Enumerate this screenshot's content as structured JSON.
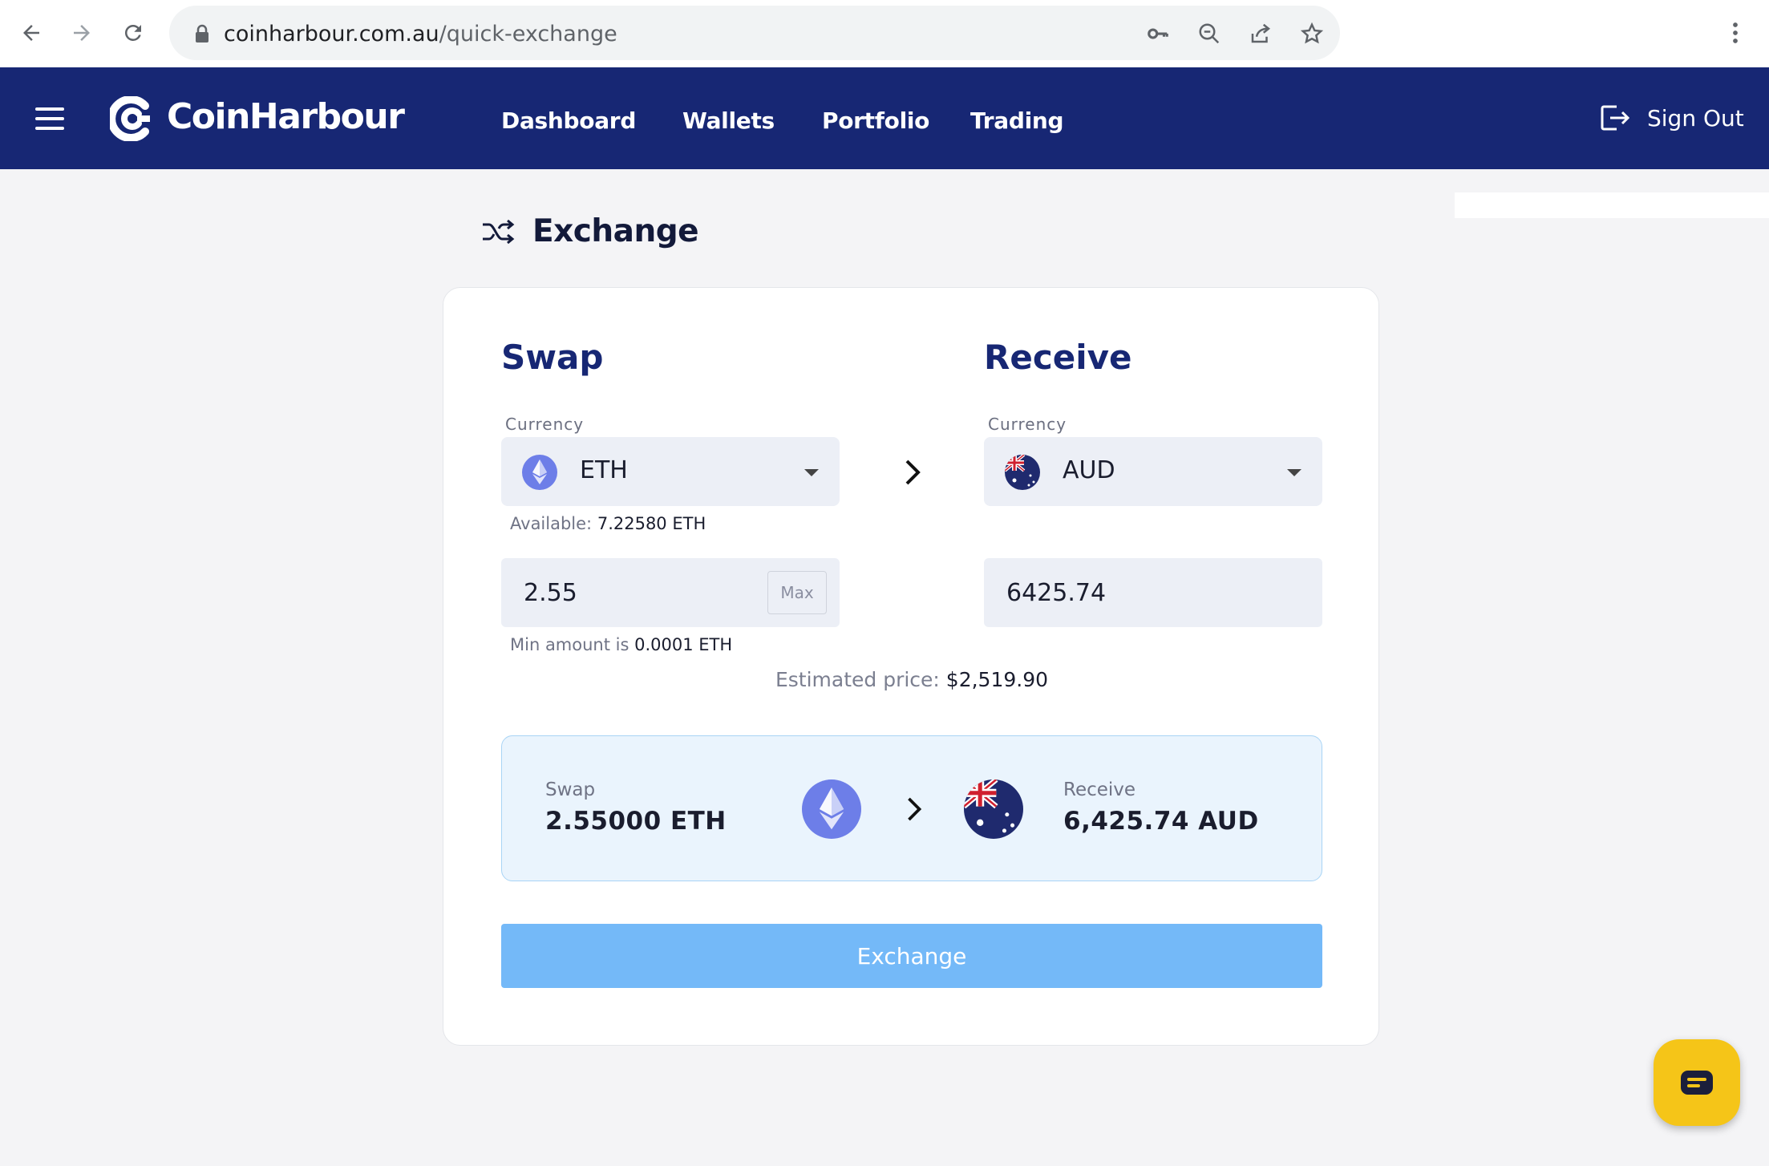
{
  "browser": {
    "url_host": "coinharbour.com.au",
    "url_path": "/quick-exchange"
  },
  "header": {
    "brand": "CoinHarbour",
    "nav": [
      "Dashboard",
      "Wallets",
      "Portfolio",
      "Trading"
    ],
    "sign_out": "Sign Out"
  },
  "page": {
    "title": "Exchange"
  },
  "swap": {
    "title": "Swap",
    "currency_label": "Currency",
    "currency": "ETH",
    "available_prefix": "Available:",
    "available_value": "7.22580 ETH",
    "amount": "2.55",
    "max_label": "Max",
    "min_prefix": "Min amount is",
    "min_value": "0.0001 ETH"
  },
  "receive": {
    "title": "Receive",
    "currency_label": "Currency",
    "currency": "AUD",
    "amount": "6425.74"
  },
  "estimate": {
    "label": "Estimated price:",
    "value": "$2,519.90"
  },
  "summary": {
    "swap_label": "Swap",
    "swap_amount": "2.55000 ETH",
    "receive_label": "Receive",
    "receive_amount": "6,425.74 AUD"
  },
  "actions": {
    "exchange": "Exchange"
  },
  "colors": {
    "header_bg": "#172774",
    "accent_title": "#172774",
    "exchange_button": "#74b9f8",
    "summary_bg": "#eaf4fd",
    "chat_fab": "#f5c518",
    "eth_coin": "#6d7ee8"
  },
  "icons": {
    "back": "arrow-left-icon",
    "forward": "arrow-right-icon",
    "reload": "reload-icon",
    "lock": "lock-icon",
    "key": "key-icon",
    "zoom": "zoom-out-icon",
    "share": "share-icon",
    "bookmark": "star-icon",
    "menu": "kebab-menu-icon",
    "exchange": "shuffle-icon",
    "chat": "chat-icon"
  }
}
